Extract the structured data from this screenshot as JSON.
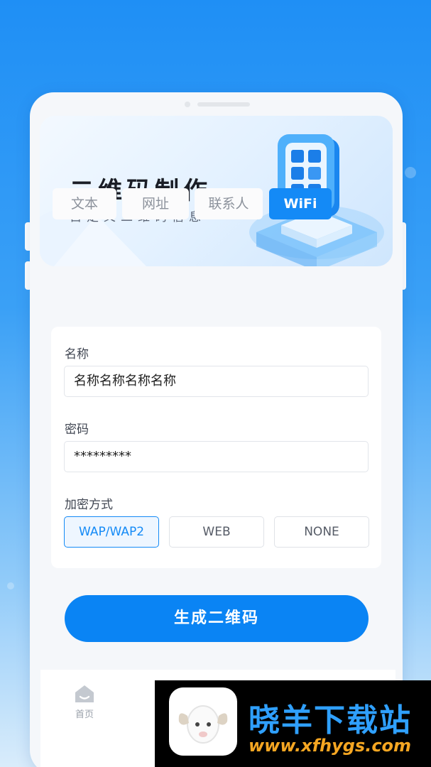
{
  "hero": {
    "title": "二维码制作",
    "subtitle": "自定义二维码信息",
    "illustration": "qr-cube-illustration"
  },
  "tabs": [
    {
      "label": "文本",
      "active": false
    },
    {
      "label": "网址",
      "active": false
    },
    {
      "label": "联系人",
      "active": false
    },
    {
      "label": "WiFi",
      "active": true
    }
  ],
  "form": {
    "name_label": "名称",
    "name_value": "名称名称名称名称",
    "password_label": "密码",
    "password_value": "*********",
    "encryption_label": "加密方式",
    "encryption_options": [
      {
        "label": "WAP/WAP2",
        "selected": true
      },
      {
        "label": "WEB",
        "selected": false
      },
      {
        "label": "NONE",
        "selected": false
      }
    ]
  },
  "generate_button": "生成二维码",
  "bottom_nav": {
    "home_label": "首页",
    "home_icon": "home-icon"
  },
  "watermark": {
    "title": "晓羊下载站",
    "url": "www.xfhygs.com",
    "logo": "sheep-logo"
  },
  "colors": {
    "accent": "#148af6",
    "button": "#0a84f4",
    "watermark_title": "#2fa0ff",
    "watermark_url": "#f5a622"
  }
}
